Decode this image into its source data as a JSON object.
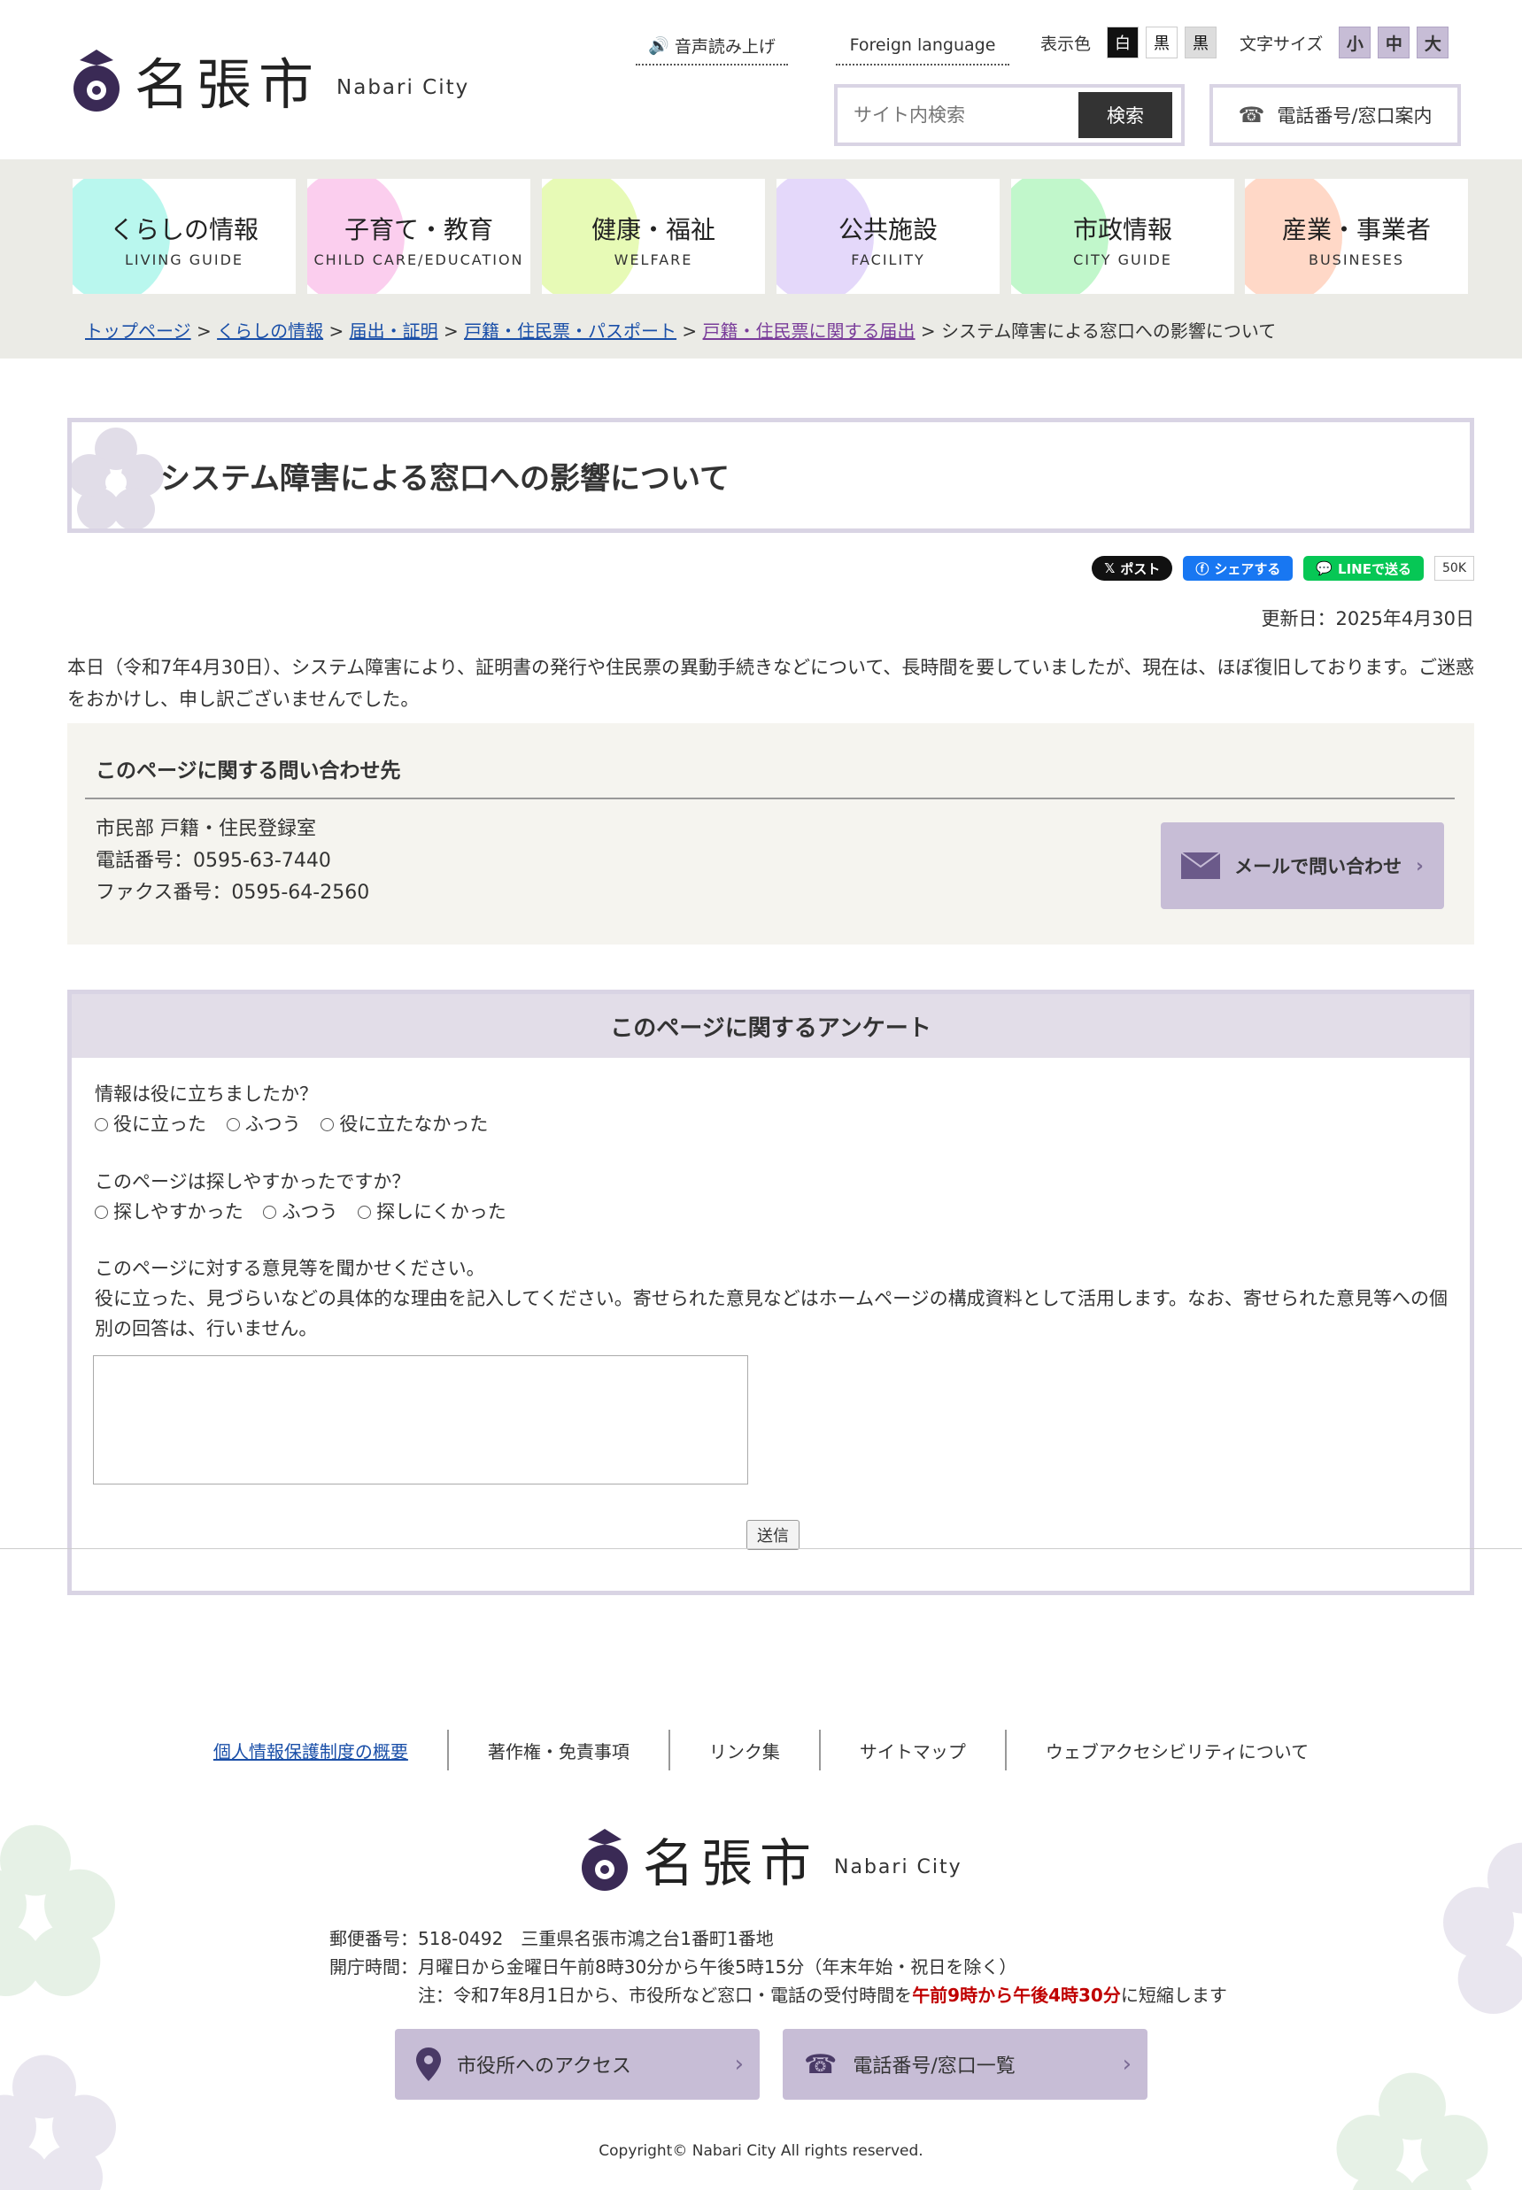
{
  "header": {
    "logo_name": "名張市",
    "logo_en": "Nabari City",
    "tts_label": "音声読み上げ",
    "foreign_label": "Foreign language",
    "color_label": "表示色",
    "color_options": [
      "白",
      "黒",
      "黒"
    ],
    "font_label": "文字サイズ",
    "font_options": [
      "小",
      "中",
      "大"
    ],
    "search_placeholder": "サイト内検索",
    "search_button": "検索",
    "phone_button": "電話番号/窓口案内"
  },
  "nav": [
    {
      "jp": "くらしの情報",
      "en": "LIVING GUIDE",
      "color": "#7ff0e0"
    },
    {
      "jp": "子育て・教育",
      "en": "CHILD CARE/EDUCATION",
      "color": "#f7a6e0"
    },
    {
      "jp": "健康・福祉",
      "en": "WELFARE",
      "color": "#d4f57a"
    },
    {
      "jp": "公共施設",
      "en": "FACILITY",
      "color": "#cdb8f5"
    },
    {
      "jp": "市政情報",
      "en": "CITY GUIDE",
      "color": "#8ef0a0"
    },
    {
      "jp": "産業・事業者",
      "en": "BUSINESES",
      "color": "#ffb899"
    }
  ],
  "breadcrumb": {
    "items": [
      "トップページ",
      "くらしの情報",
      "届出・証明",
      "戸籍・住民票・パスポート",
      "戸籍・住民票に関する届出"
    ],
    "current": "システム障害による窓口への影響について"
  },
  "page": {
    "title": "システム障害による窓口への影響について",
    "updated": "更新日：2025年4月30日",
    "body": "本日（令和7年4月30日）、システム障害により、証明書の発行や住民票の異動手続きなどについて、長時間を要していましたが、現在は、ほぼ復旧しております。ご迷惑をおかけし、申し訳ございませんでした。"
  },
  "social": {
    "post": "ポスト",
    "share": "シェアする",
    "line": "LINEで送る",
    "count": "50K"
  },
  "contact": {
    "title": "このページに関する問い合わせ先",
    "dept": "市民部 戸籍・住民登録室",
    "phone": "電話番号：0595-63-7440",
    "fax": "ファクス番号：0595-64-2560",
    "mail_button": "メールで問い合わせ"
  },
  "survey": {
    "title": "このページに関するアンケート",
    "q1": "情報は役に立ちましたか？",
    "q1_options": [
      "役に立った",
      "ふつう",
      "役に立たなかった"
    ],
    "q2": "このページは探しやすかったですか？",
    "q2_options": [
      "探しやすかった",
      "ふつう",
      "探しにくかった"
    ],
    "q3": "このページに対する意見等を聞かせください。",
    "q3_note": "役に立った、見づらいなどの具体的な理由を記入してください。寄せられた意見などはホームページの構成資料として活用します。なお、寄せられた意見等への個別の回答は、行いません。",
    "submit": "送信"
  },
  "footer": {
    "links": [
      "個人情報保護制度の概要",
      "著作権・免責事項",
      "リンク集",
      "サイトマップ",
      "ウェブアクセシビリティについて"
    ],
    "postal": "郵便番号：518-0492　三重県名張市鴻之台1番町1番地",
    "hours": "開庁時間：月曜日から金曜日午前8時30分から午後5時15分（年末年始・祝日を除く）",
    "note_pre": "注：令和7年8月1日から、市役所など窓口・電話の受付時間を",
    "note_red": "午前9時から午後4時30分",
    "note_post": "に短縮します",
    "access_button": "市役所へのアクセス",
    "phone_list_button": "電話番号/窓口一覧",
    "copyright": "Copyright© Nabari City All rights reserved."
  },
  "colors": {
    "accent": "#c7bdd6",
    "nav_band": "#ebebe6",
    "contact_bg": "#f5f4ef",
    "survey_head": "#e2dde8",
    "link": "#1a4fa8",
    "warning": "#c00000"
  }
}
